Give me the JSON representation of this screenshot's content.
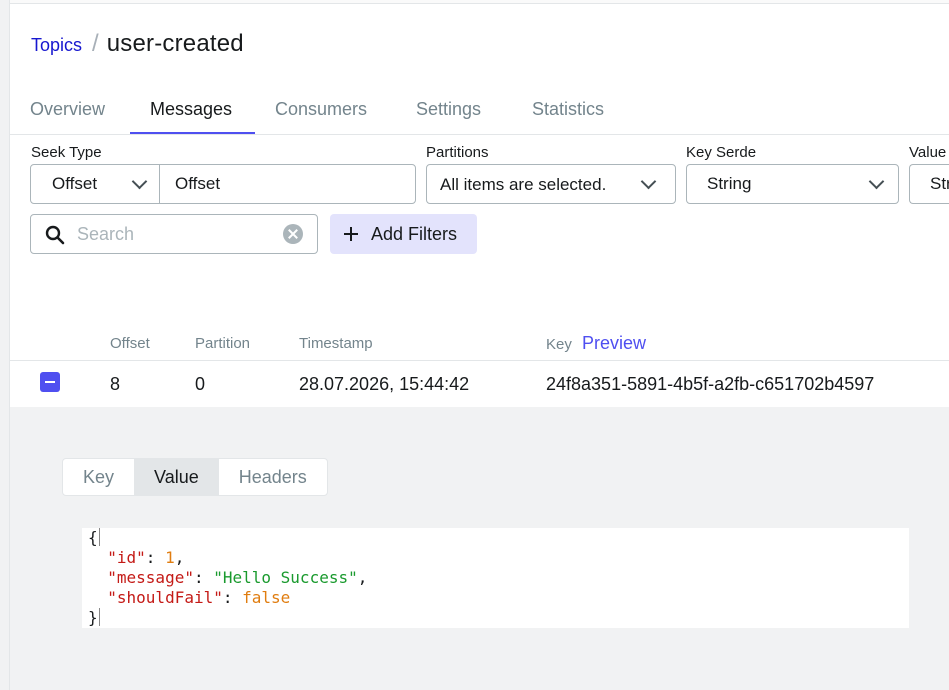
{
  "breadcrumb": {
    "parent": "Topics",
    "separator": "/",
    "current": "user-created"
  },
  "tabs": [
    "Overview",
    "Messages",
    "Consumers",
    "Settings",
    "Statistics"
  ],
  "active_tab": "Messages",
  "filters": {
    "seek_type": {
      "label": "Seek Type",
      "selected": "Offset",
      "value": "Offset"
    },
    "partitions": {
      "label": "Partitions",
      "value": "All items are selected."
    },
    "key_serde": {
      "label": "Key Serde",
      "value": "String"
    },
    "value_serde": {
      "label": "Value",
      "value": "Str"
    },
    "search": {
      "placeholder": "Search"
    },
    "add_filters_label": "Add Filters"
  },
  "table": {
    "columns": {
      "offset": "Offset",
      "partition": "Partition",
      "timestamp": "Timestamp",
      "key": "Key"
    },
    "preview_label": "Preview",
    "row": {
      "offset": "8",
      "partition": "0",
      "timestamp": "28.07.2026, 15:44:42",
      "key": "24f8a351-5891-4b5f-a2fb-c651702b4597"
    }
  },
  "message_tabs": [
    "Key",
    "Value",
    "Headers"
  ],
  "active_message_tab": "Value",
  "message": {
    "open_brace": "{",
    "close_brace": "}",
    "fields": [
      {
        "key": "\"id\"",
        "value": "1",
        "type": "number",
        "trail": ","
      },
      {
        "key": "\"message\"",
        "value": "\"Hello Success\"",
        "type": "string",
        "trail": ","
      },
      {
        "key": "\"shouldFail\"",
        "value": "false",
        "type": "bool",
        "trail": ""
      }
    ]
  },
  "colors": {
    "accent": "#4f4ff0",
    "link": "#1717cf",
    "json_key": "#c41a16",
    "json_string": "#1a9a2e",
    "json_literal": "#e07d10"
  }
}
